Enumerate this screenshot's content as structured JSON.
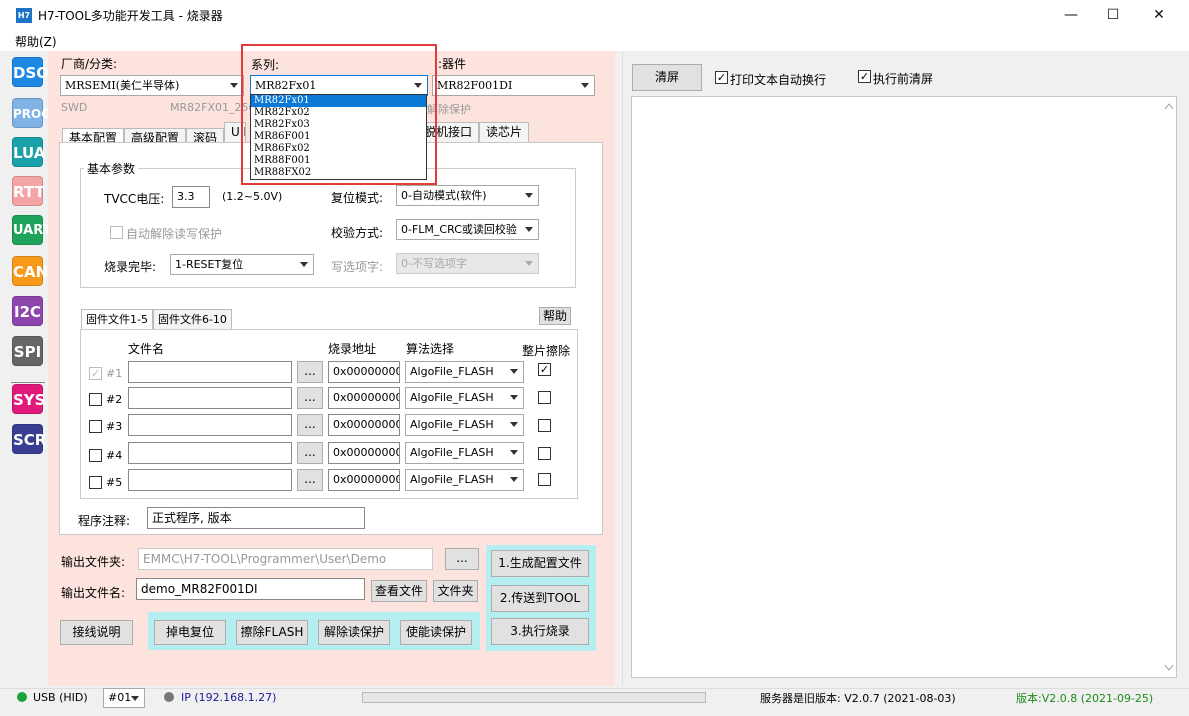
{
  "window": {
    "app_icon": "H7",
    "title": "H7-TOOL多功能开发工具 - 烧录器",
    "minimize": "—",
    "maximize": "☐",
    "close": "✕"
  },
  "menu": {
    "help": "帮助(Z)"
  },
  "nav": [
    "DSO",
    "PROG",
    "LUA",
    "RTT",
    "UART",
    "CAN",
    "I2C",
    "SPI",
    "SYS",
    "SCR"
  ],
  "nav_colors": {
    "DSO": "#1e88e5",
    "PROG": "#7fb2e5",
    "LUA": "#19a0a8",
    "RTT": "#f4a4a4",
    "UART": "#1fa25a",
    "CAN": "#f79a1b",
    "I2C": "#8e44ad",
    "SPI": "#666666",
    "SYS": "#e0197a",
    "SCR": "#3a3e92"
  },
  "vendor": {
    "label": "厂商/分类:",
    "value": "MRSEMI(美仁半导体)"
  },
  "series": {
    "label": "系列:",
    "value": "MR82Fx01",
    "options": [
      "MR82Fx01",
      "MR82Fx02",
      "MR82Fx03",
      "MR86F001",
      "MR86Fx02",
      "MR88F001",
      "MR88FX02"
    ]
  },
  "device": {
    "label": "器件:",
    "value": "MR82F001DI"
  },
  "info": {
    "interface": "SWD",
    "chip_info": "MR82FX01_256.",
    "unprotect_hint": "解除保护"
  },
  "tabs": [
    "基本配置",
    "高级配置",
    "滚码",
    "UID",
    "脱机接口",
    "读芯片"
  ],
  "basic": {
    "group_title": "基本参数",
    "tvcc_label": "TVCC电压:",
    "tvcc_value": "3.3",
    "tvcc_range": "(1.2~5.0V)",
    "auto_unlock": "自动解除读写保护",
    "finish_label": "烧录完毕:",
    "finish_value": "1-RESET复位",
    "reset_label": "复位模式:",
    "reset_value": "0-自动模式(软件)",
    "verify_label": "校验方式:",
    "verify_value": "0-FLM_CRC或读回校验",
    "option_label": "写选项字:",
    "option_value": "0-不写选项字"
  },
  "firmware": {
    "tab1": "固件文件1-5",
    "tab2": "固件文件6-10",
    "help": "帮助",
    "col_file": "文件名",
    "col_addr": "烧录地址",
    "col_algo": "算法选择",
    "col_erase": "整片擦除",
    "browse": "...",
    "rows": [
      {
        "num": "#1",
        "addr": "0x00000000",
        "algo": "AlgoFile_FLASH",
        "enabled": "✓",
        "erase": "✓"
      },
      {
        "num": "#2",
        "addr": "0x00000000",
        "algo": "AlgoFile_FLASH",
        "enabled": "",
        "erase": ""
      },
      {
        "num": "#3",
        "addr": "0x00000000",
        "algo": "AlgoFile_FLASH",
        "enabled": "",
        "erase": ""
      },
      {
        "num": "#4",
        "addr": "0x00000000",
        "algo": "AlgoFile_FLASH",
        "enabled": "",
        "erase": ""
      },
      {
        "num": "#5",
        "addr": "0x00000000",
        "algo": "AlgoFile_FLASH",
        "enabled": "",
        "erase": ""
      }
    ]
  },
  "note": {
    "label": "程序注释:",
    "value": "正式程序, 版本"
  },
  "output": {
    "folder_label": "输出文件夹:",
    "folder_value": "EMMC\\H7-TOOL\\Programmer\\User\\Demo",
    "browse": "...",
    "name_label": "输出文件名:",
    "name_value": "demo_MR82F001DI",
    "view_file": "查看文件",
    "open_folder": "文件夹"
  },
  "actions": {
    "gen_config": "1.生成配置文件",
    "send_tool": "2.传送到TOOL",
    "exec_burn": "3.执行烧录",
    "wiring": "接线说明",
    "power_reset": "掉电复位",
    "erase_flash": "擦除FLASH",
    "unprotect": "解除读保护",
    "enable_protect": "使能读保护"
  },
  "log": {
    "clear": "清屏",
    "autowrap": "打印文本自动换行",
    "clear_before": "执行前清屏",
    "autowrap_checked": "✓",
    "clear_before_checked": "✓"
  },
  "status": {
    "usb": "USB (HID)",
    "port": "#01",
    "ip": "IP (192.168.1.27)",
    "server": "服务器是旧版本: V2.0.7 (2021-08-03)",
    "version": "版本:V2.0.8 (2021-09-25)",
    "usb_color": "#1aa33a",
    "ip_color": "#777777"
  }
}
